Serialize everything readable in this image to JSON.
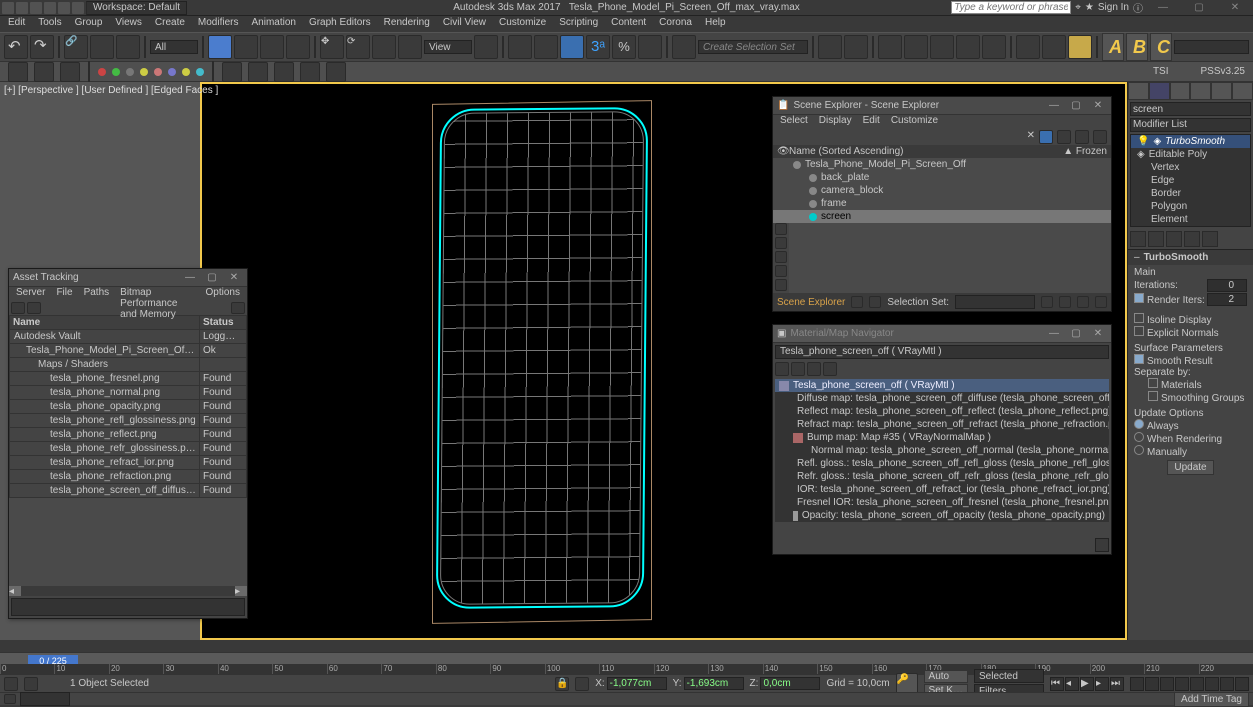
{
  "titlebar": {
    "workspace": "Workspace: Default",
    "app": "Autodesk 3ds Max 2017",
    "file": "Tesla_Phone_Model_Pi_Screen_Off_max_vray.max",
    "search_placeholder": "Type a keyword or phrase",
    "signin": "Sign In"
  },
  "menubar": [
    "Edit",
    "Tools",
    "Group",
    "Views",
    "Create",
    "Modifiers",
    "Animation",
    "Graph Editors",
    "Rendering",
    "Civil View",
    "Customize",
    "Scripting",
    "Content",
    "Corona",
    "Help"
  ],
  "toolbar2": {
    "all": "All",
    "view": "View",
    "selset": "Create Selection Set",
    "letters": [
      "A",
      "B",
      "C"
    ]
  },
  "subbar": {
    "tsi": "TSI",
    "pss": "PSSv3.25"
  },
  "viewport": {
    "label": "[+] [Perspective ]   [User Defined ]   [Edged Faces ]"
  },
  "asset_tracking": {
    "title": "Asset Tracking",
    "menu": [
      "Server",
      "File",
      "Paths",
      "Bitmap Performance and Memory",
      "Options"
    ],
    "columns": [
      "Name",
      "Status"
    ],
    "rows": [
      {
        "name": "Autodesk Vault",
        "status": "Logg…",
        "depth": 0
      },
      {
        "name": "Tesla_Phone_Model_Pi_Screen_Off_max_vray.max",
        "status": "Ok",
        "depth": 1
      },
      {
        "name": "Maps / Shaders",
        "status": "",
        "depth": 2
      },
      {
        "name": "tesla_phone_fresnel.png",
        "status": "Found",
        "depth": 3
      },
      {
        "name": "tesla_phone_normal.png",
        "status": "Found",
        "depth": 3
      },
      {
        "name": "tesla_phone_opacity.png",
        "status": "Found",
        "depth": 3
      },
      {
        "name": "tesla_phone_refl_glossiness.png",
        "status": "Found",
        "depth": 3
      },
      {
        "name": "tesla_phone_reflect.png",
        "status": "Found",
        "depth": 3
      },
      {
        "name": "tesla_phone_refr_glossiness.png",
        "status": "Found",
        "depth": 3
      },
      {
        "name": "tesla_phone_refract_ior.png",
        "status": "Found",
        "depth": 3
      },
      {
        "name": "tesla_phone_refraction.png",
        "status": "Found",
        "depth": 3
      },
      {
        "name": "tesla_phone_screen_off_diffuse.png",
        "status": "Found",
        "depth": 3
      }
    ]
  },
  "scene_explorer": {
    "title": "Scene Explorer - Scene Explorer",
    "menu": [
      "Select",
      "Display",
      "Edit",
      "Customize"
    ],
    "name_header": "Name (Sorted Ascending)",
    "frozen": "▲ Frozen",
    "nodes": [
      {
        "label": "Tesla_Phone_Model_Pi_Screen_Off",
        "depth": 0
      },
      {
        "label": "back_plate",
        "depth": 1
      },
      {
        "label": "camera_block",
        "depth": 1
      },
      {
        "label": "frame",
        "depth": 1
      },
      {
        "label": "screen",
        "depth": 1,
        "selected": true
      }
    ],
    "footer_label": "Scene Explorer",
    "selset_label": "Selection Set:"
  },
  "matnav": {
    "title": "Material/Map Navigator",
    "header": "Tesla_phone_screen_off  ( VRayMtl )",
    "rows": [
      {
        "text": "Tesla_phone_screen_off  ( VRayMtl )",
        "selected": true
      },
      {
        "text": "Diffuse map: tesla_phone_screen_off_diffuse (tesla_phone_screen_off_diffuse.png)"
      },
      {
        "text": "Reflect map: tesla_phone_screen_off_reflect (tesla_phone_reflect.png)"
      },
      {
        "text": "Refract map: tesla_phone_screen_off_refract (tesla_phone_refraction.png)"
      },
      {
        "text": "Bump map: Map #35  ( VRayNormalMap )"
      },
      {
        "text": "Normal map: tesla_phone_screen_off_normal (tesla_phone_normal.png)"
      },
      {
        "text": "Refl. gloss.: tesla_phone_screen_off_refl_gloss (tesla_phone_refl_glossiness.png)"
      },
      {
        "text": "Refr. gloss.: tesla_phone_screen_off_refr_gloss (tesla_phone_refr_glossiness.png)"
      },
      {
        "text": "IOR: tesla_phone_screen_off_refract_ior (tesla_phone_refract_ior.png)"
      },
      {
        "text": "Fresnel IOR: tesla_phone_screen_off_fresnel (tesla_phone_fresnel.png)"
      },
      {
        "text": "Opacity: tesla_phone_screen_off_opacity (tesla_phone_opacity.png)"
      }
    ]
  },
  "cmdpanel": {
    "search": "screen",
    "modifier_list": "Modifier List",
    "stack": [
      {
        "label": "TurboSmooth",
        "sel": true,
        "sub": false,
        "bullet": true,
        "eye": true
      },
      {
        "label": "Editable Poly",
        "sel": false,
        "sub": false,
        "bullet": true
      },
      {
        "label": "Vertex",
        "sub": true
      },
      {
        "label": "Edge",
        "sub": true
      },
      {
        "label": "Border",
        "sub": true
      },
      {
        "label": "Polygon",
        "sub": true
      },
      {
        "label": "Element",
        "sub": true
      }
    ],
    "rollout_header": "TurboSmooth",
    "main_label": "Main",
    "iterations_label": "Iterations:",
    "iterations_value": "0",
    "render_iters_label": "Render Iters:",
    "render_iters_value": "2",
    "isoline": "Isoline Display",
    "explicit": "Explicit Normals",
    "surfparam": "Surface Parameters",
    "smoothres": "Smooth Result",
    "separate": "Separate by:",
    "materials": "Materials",
    "smoothgrp": "Smoothing Groups",
    "updateopts": "Update Options",
    "always": "Always",
    "whenrend": "When Rendering",
    "manually": "Manually",
    "update_btn": "Update"
  },
  "timeline": {
    "cursor": "0 / 225",
    "ticks": [
      "0",
      "10",
      "20",
      "30",
      "40",
      "50",
      "60",
      "70",
      "80",
      "90",
      "100",
      "110",
      "120",
      "130",
      "140",
      "150",
      "160",
      "170",
      "180",
      "190",
      "200",
      "210",
      "220"
    ]
  },
  "status": {
    "selection": "1 Object Selected",
    "x_lbl": "X:",
    "x_val": "-1,077cm",
    "y_lbl": "Y:",
    "y_val": "-1,693cm",
    "z_lbl": "Z:",
    "z_val": "0,0cm",
    "grid": "Grid = 10,0cm",
    "auto": "Auto",
    "sel": "Selected",
    "setk": "Set K…",
    "filters": "Filters…",
    "addtag": "Add Time Tag"
  }
}
